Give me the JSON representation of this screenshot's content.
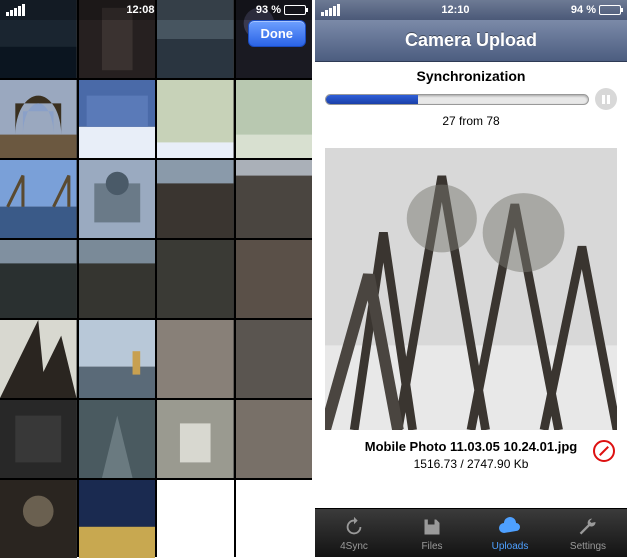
{
  "left": {
    "status": {
      "time": "12:08",
      "battery_pct": "93 %"
    },
    "nav": {
      "done": "Done"
    },
    "grid": {
      "rows": 7,
      "cols": 4,
      "count_last_row": 2
    }
  },
  "right": {
    "status": {
      "time": "12:10",
      "battery_pct": "94 %"
    },
    "title": "Camera Upload",
    "sync": {
      "label": "Synchronization",
      "done": 27,
      "total": 78,
      "count_text": "27 from 78",
      "progress_pct": 35
    },
    "file": {
      "name": "Mobile Photo 11.03.05 10.24.01.jpg",
      "size_text": "1516.73 / 2747.90 Kb"
    },
    "tabs": [
      {
        "id": "4sync",
        "label": "4Sync",
        "active": false
      },
      {
        "id": "files",
        "label": "Files",
        "active": false
      },
      {
        "id": "uploads",
        "label": "Uploads",
        "active": true
      },
      {
        "id": "settings",
        "label": "Settings",
        "active": false
      }
    ]
  }
}
